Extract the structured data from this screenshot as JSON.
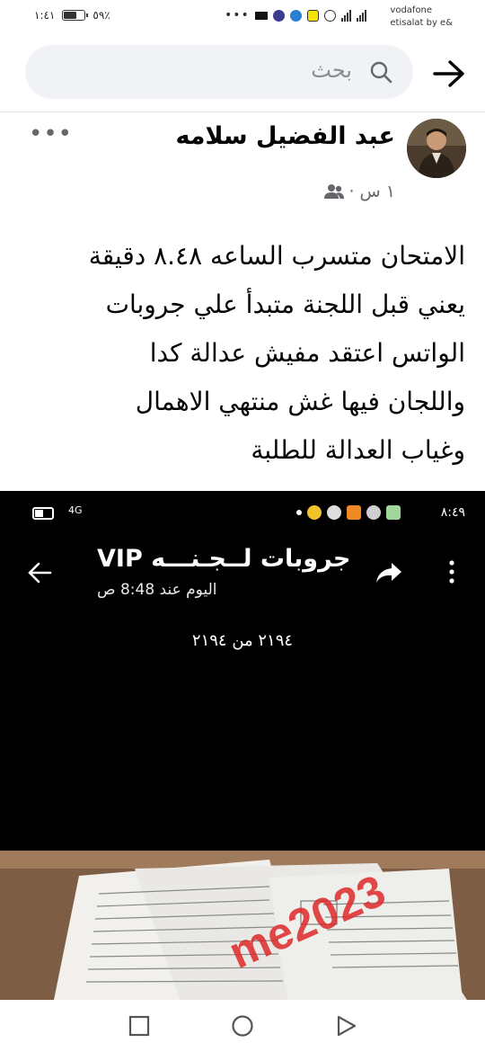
{
  "status_bar": {
    "time": "١:٤١",
    "battery": "٥٩٪",
    "carrier_line1": "vodafone",
    "carrier_line2": "etisalat by e&",
    "notification_icons": [
      "more-dots-icon",
      "black-box-icon",
      "messenger-icon",
      "globe-icon",
      "snapchat-icon",
      "whatsapp-icon"
    ]
  },
  "search": {
    "placeholder": "بحث"
  },
  "post": {
    "author": "عبد الفضيل سلامه",
    "time": "١ س",
    "separator": "·",
    "privacy_icon": "friends-icon",
    "text_lines": [
      "الامتحان متسرب الساعه ٨.٤٨ دقيقة",
      "يعني قبل اللجنة متبدأ علي جروبات",
      "الواتس اعتقد مفيش عدالة كدا",
      "واللجان فيها غش منتهي الاهمال",
      "وغياب العدالة للطلبة"
    ]
  },
  "photo": {
    "status_time": "٨:٤٩",
    "network": "4G",
    "chat_title": "جروبات لــجـنـــه VIP",
    "chat_subtitle": "اليوم عند 8:48 ص",
    "image_counter": "٢١٩٤ من ٢١٩٤",
    "watermark": "me2023",
    "paper_color": "#8a6a4f"
  },
  "navbar": {
    "icons": [
      "recent-apps-icon",
      "home-icon",
      "back-icon"
    ]
  }
}
